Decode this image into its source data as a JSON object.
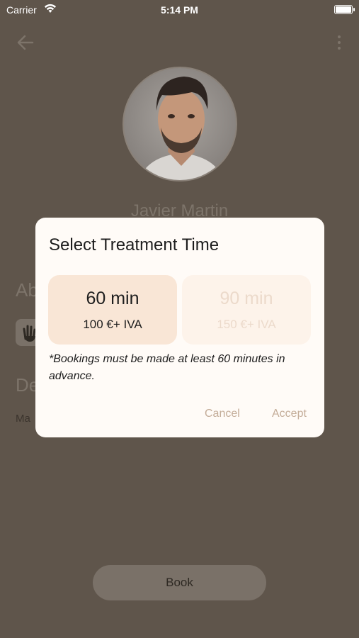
{
  "status_bar": {
    "carrier": "Carrier",
    "time": "5:14 PM",
    "icons": [
      "wifi-icon",
      "battery-icon"
    ]
  },
  "header": {
    "back_icon": "arrow-left-icon",
    "more_icon": "vertical-dots-icon"
  },
  "profile": {
    "name": "Javier Martin",
    "about_heading": "Ab",
    "description_heading": "De",
    "description_text": "Ma"
  },
  "book_button": {
    "label": "Book"
  },
  "dialog": {
    "title": "Select Treatment Time",
    "options": [
      {
        "duration": "60 min",
        "price": "100 €+ IVA",
        "selected": true
      },
      {
        "duration": "90 min",
        "price": "150 €+ IVA",
        "selected": false
      }
    ],
    "notice": "*Bookings must be made at least 60 minutes in advance.",
    "cancel_label": "Cancel",
    "accept_label": "Accept"
  },
  "colors": {
    "overlay_background": "#5f554b",
    "dialog_background": "#fffbf7",
    "selected_option": "#f9e6d6",
    "unselected_option": "#fdf3ea",
    "action_text": "#c4ad99"
  }
}
